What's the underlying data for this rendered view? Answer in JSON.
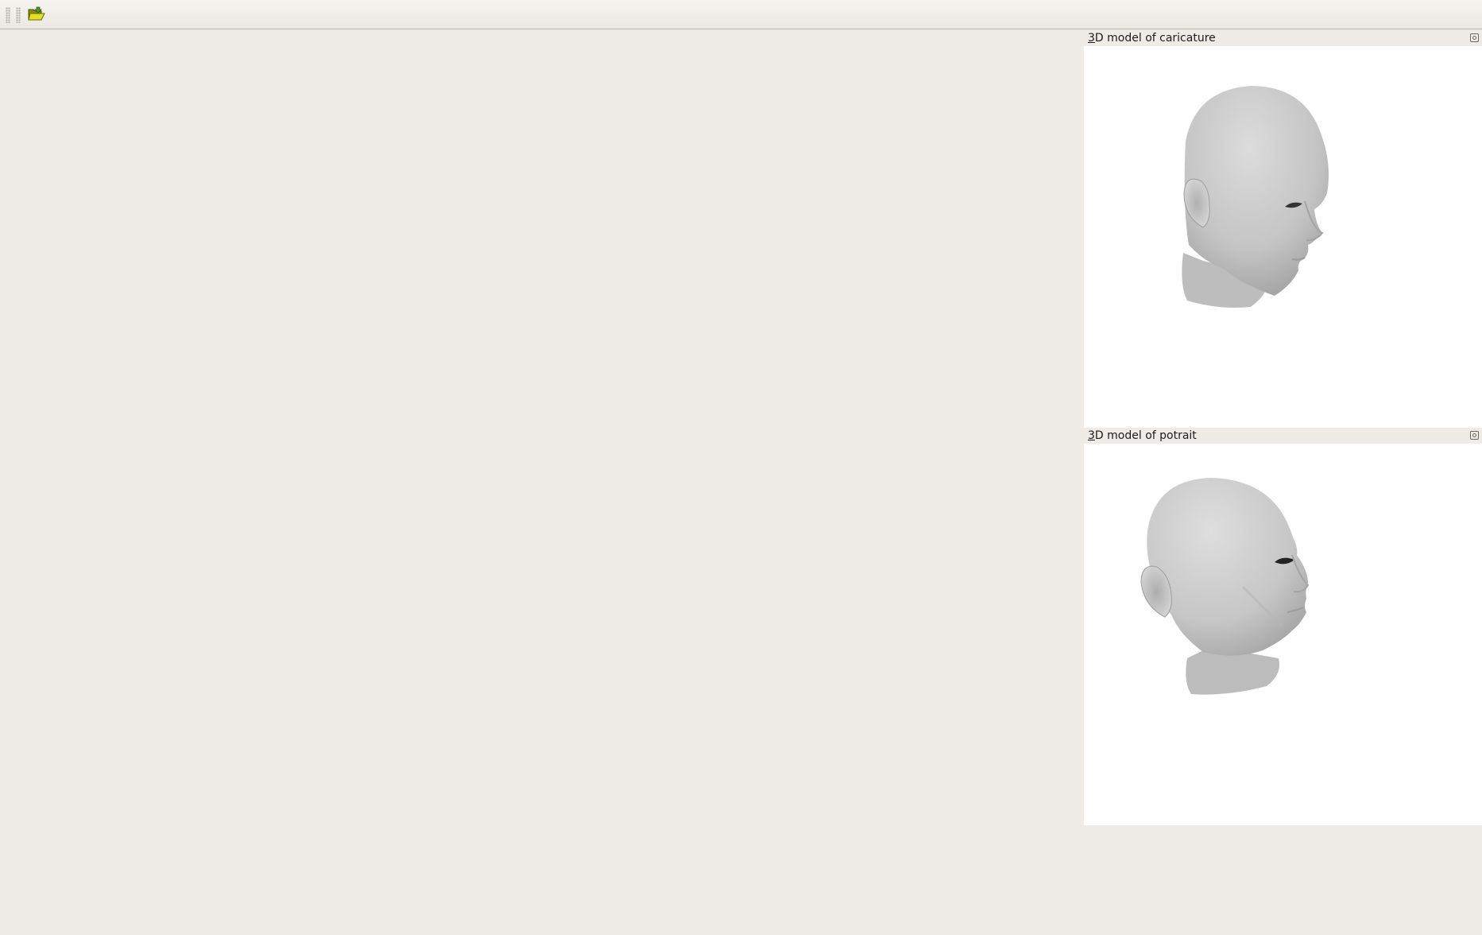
{
  "toolbar": {
    "open_icon": "folder-open-icon"
  },
  "docks": [
    {
      "title_accel": "3",
      "title_rest": "D model of caricature",
      "close_icon": "dock-close-icon",
      "content": "3d-head-model-caricature"
    },
    {
      "title_accel": "3",
      "title_rest": "D model of potrait",
      "close_icon": "dock-close-icon",
      "content": "3d-head-model-portrait"
    }
  ],
  "colors": {
    "window_bg": "#efebe7",
    "viewport_bg": "#ffffff",
    "model_shade": "#c8c8c8"
  }
}
